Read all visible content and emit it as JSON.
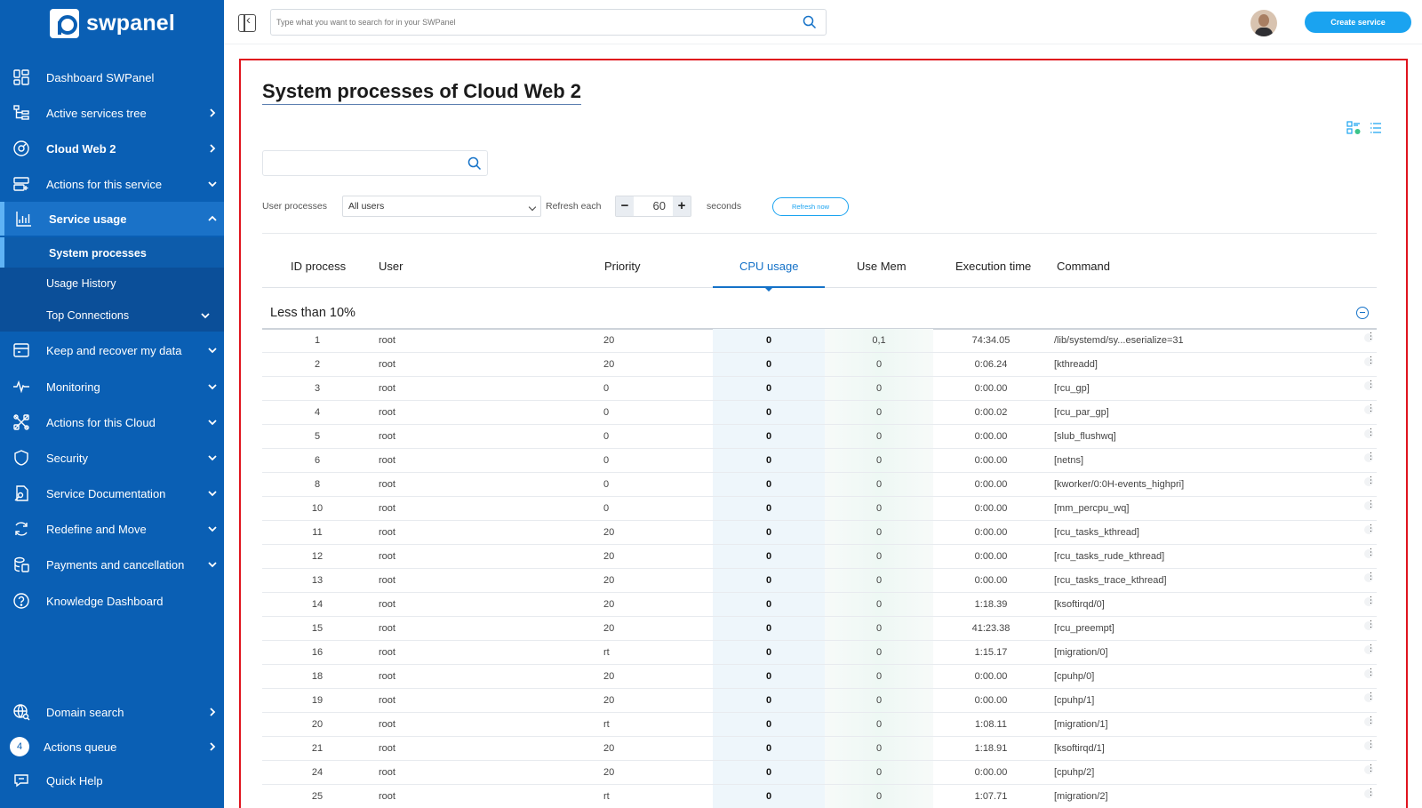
{
  "brand": {
    "name": "swpanel"
  },
  "sidebar": {
    "items": [
      {
        "label": "Dashboard SWPanel",
        "icon": "dashboard-icon"
      },
      {
        "label": "Active services tree",
        "icon": "tree-icon"
      },
      {
        "label": "Cloud Web 2",
        "icon": "cloud-service-icon"
      },
      {
        "label": "Actions for this service",
        "icon": "server-actions-icon"
      },
      {
        "label": "Service usage",
        "icon": "chart-icon"
      },
      {
        "label": "Keep and recover my data",
        "icon": "backup-icon"
      },
      {
        "label": "Monitoring",
        "icon": "pulse-icon"
      },
      {
        "label": "Actions for this Cloud",
        "icon": "tools-icon"
      },
      {
        "label": "Security",
        "icon": "shield-icon"
      },
      {
        "label": "Service Documentation",
        "icon": "document-icon"
      },
      {
        "label": "Redefine and Move",
        "icon": "refresh-icon"
      },
      {
        "label": "Payments and cancellation",
        "icon": "payments-icon"
      },
      {
        "label": "Knowledge Dashboard",
        "icon": "help-circle-icon"
      }
    ],
    "sub_items": [
      {
        "label": "System processes"
      },
      {
        "label": "Usage History"
      },
      {
        "label": "Top Connections"
      }
    ],
    "bottom": {
      "domain_search": "Domain search",
      "actions_queue": "Actions queue",
      "actions_queue_count": "4",
      "quick_help": "Quick Help"
    }
  },
  "topbar": {
    "search_placeholder": "Type what you want to search for in your SWPanel",
    "create_label": "Create service"
  },
  "page": {
    "title": "System processes of Cloud Web 2",
    "filter_placeholder": "",
    "user_processes_label": "User processes",
    "user_select_value": "All users",
    "refresh_each_label": "Refresh each",
    "refresh_value": "60",
    "seconds_label": "seconds",
    "refresh_now_label": "Refresh now"
  },
  "table": {
    "columns": [
      "ID process",
      "User",
      "Priority",
      "CPU usage",
      "Use Mem",
      "Execution time",
      "Command"
    ],
    "sorted_column": "CPU usage",
    "group_title": "Less than 10%",
    "rows": [
      {
        "id": "1",
        "user": "root",
        "priority": "20",
        "cpu": "0",
        "mem": "0,1",
        "time": "74:34.05",
        "command": "/lib/systemd/sy...eserialize=31"
      },
      {
        "id": "2",
        "user": "root",
        "priority": "20",
        "cpu": "0",
        "mem": "0",
        "time": "0:06.24",
        "command": "[kthreadd]"
      },
      {
        "id": "3",
        "user": "root",
        "priority": "0",
        "cpu": "0",
        "mem": "0",
        "time": "0:00.00",
        "command": "[rcu_gp]"
      },
      {
        "id": "4",
        "user": "root",
        "priority": "0",
        "cpu": "0",
        "mem": "0",
        "time": "0:00.02",
        "command": "[rcu_par_gp]"
      },
      {
        "id": "5",
        "user": "root",
        "priority": "0",
        "cpu": "0",
        "mem": "0",
        "time": "0:00.00",
        "command": "[slub_flushwq]"
      },
      {
        "id": "6",
        "user": "root",
        "priority": "0",
        "cpu": "0",
        "mem": "0",
        "time": "0:00.00",
        "command": "[netns]"
      },
      {
        "id": "8",
        "user": "root",
        "priority": "0",
        "cpu": "0",
        "mem": "0",
        "time": "0:00.00",
        "command": "[kworker/0:0H-events_highpri]"
      },
      {
        "id": "10",
        "user": "root",
        "priority": "0",
        "cpu": "0",
        "mem": "0",
        "time": "0:00.00",
        "command": "[mm_percpu_wq]"
      },
      {
        "id": "11",
        "user": "root",
        "priority": "20",
        "cpu": "0",
        "mem": "0",
        "time": "0:00.00",
        "command": "[rcu_tasks_kthread]"
      },
      {
        "id": "12",
        "user": "root",
        "priority": "20",
        "cpu": "0",
        "mem": "0",
        "time": "0:00.00",
        "command": "[rcu_tasks_rude_kthread]"
      },
      {
        "id": "13",
        "user": "root",
        "priority": "20",
        "cpu": "0",
        "mem": "0",
        "time": "0:00.00",
        "command": "[rcu_tasks_trace_kthread]"
      },
      {
        "id": "14",
        "user": "root",
        "priority": "20",
        "cpu": "0",
        "mem": "0",
        "time": "1:18.39",
        "command": "[ksoftirqd/0]"
      },
      {
        "id": "15",
        "user": "root",
        "priority": "20",
        "cpu": "0",
        "mem": "0",
        "time": "41:23.38",
        "command": "[rcu_preempt]"
      },
      {
        "id": "16",
        "user": "root",
        "priority": "rt",
        "cpu": "0",
        "mem": "0",
        "time": "1:15.17",
        "command": "[migration/0]"
      },
      {
        "id": "18",
        "user": "root",
        "priority": "20",
        "cpu": "0",
        "mem": "0",
        "time": "0:00.00",
        "command": "[cpuhp/0]"
      },
      {
        "id": "19",
        "user": "root",
        "priority": "20",
        "cpu": "0",
        "mem": "0",
        "time": "0:00.00",
        "command": "[cpuhp/1]"
      },
      {
        "id": "20",
        "user": "root",
        "priority": "rt",
        "cpu": "0",
        "mem": "0",
        "time": "1:08.11",
        "command": "[migration/1]"
      },
      {
        "id": "21",
        "user": "root",
        "priority": "20",
        "cpu": "0",
        "mem": "0",
        "time": "1:18.91",
        "command": "[ksoftirqd/1]"
      },
      {
        "id": "24",
        "user": "root",
        "priority": "20",
        "cpu": "0",
        "mem": "0",
        "time": "0:00.00",
        "command": "[cpuhp/2]"
      },
      {
        "id": "25",
        "user": "root",
        "priority": "rt",
        "cpu": "0",
        "mem": "0",
        "time": "1:07.71",
        "command": "[migration/2]"
      }
    ]
  },
  "colors": {
    "sidebar_bg": "#0a5fb4",
    "accent": "#1aa3f0",
    "sorted_column": "#1572c8",
    "highlight_frame": "#e0141e"
  }
}
